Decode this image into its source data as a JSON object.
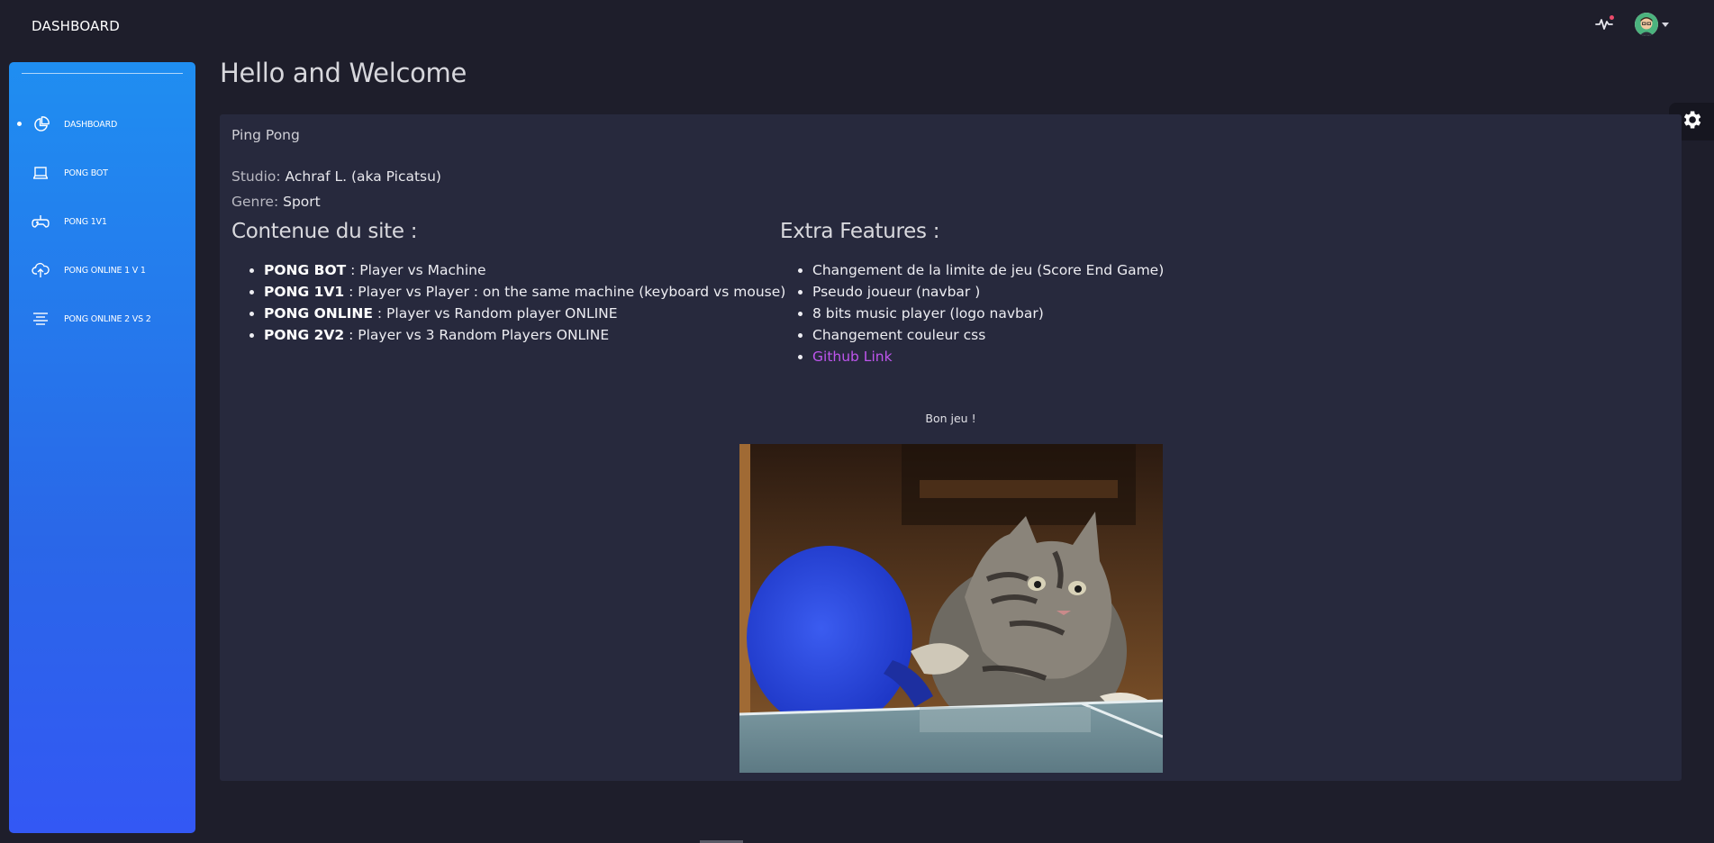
{
  "navbar": {
    "brand": "DASHBOARD",
    "activity_icon": "activity-pulse-icon",
    "notification_color": "#ec4b6b",
    "avatar_icon": "user-avatar"
  },
  "sidebar": {
    "items": [
      {
        "label": "DASHBOARD",
        "icon": "chart-pie-icon",
        "active": true
      },
      {
        "label": "PONG BOT",
        "icon": "laptop-icon"
      },
      {
        "label": "PONG 1V1",
        "icon": "controller-icon"
      },
      {
        "label": "PONG ONLINE 1 V 1",
        "icon": "cloud-upload-icon"
      },
      {
        "label": "PONG ONLINE 2 VS 2",
        "icon": "align-center-icon"
      }
    ]
  },
  "page": {
    "title": "Hello and Welcome"
  },
  "game": {
    "title": "Ping Pong",
    "studio_label": "Studio:",
    "studio_value": "Achraf L. (aka Picatsu)",
    "genre_label": "Genre:",
    "genre_value": "Sport",
    "content": {
      "heading": "Contenue du site :",
      "items": [
        {
          "name": "PONG BOT",
          "desc": " : Player vs Machine"
        },
        {
          "name": "PONG 1V1",
          "desc": " : Player vs Player : on the same machine (keyboard vs mouse)"
        },
        {
          "name": "PONG ONLINE",
          "desc": " : Player vs Random player ONLINE"
        },
        {
          "name": "PONG 2V2",
          "desc": " : Player vs 3 Random Players ONLINE"
        }
      ]
    },
    "features": {
      "heading": "Extra Features :",
      "items": [
        "Changement de la limite de jeu (Score End Game)",
        "Pseudo joueur (navbar )",
        "8 bits music player (logo navbar)",
        "Changement couleur css"
      ],
      "link_label": "Github Link"
    },
    "farewell": "Bon jeu !",
    "image": "cat-playing-ping-pong-picture"
  },
  "colors": {
    "sidebar_gradient_start": "#1f8ef1",
    "sidebar_gradient_end": "#3358f4",
    "background": "#1e1e2b",
    "card": "#27293d",
    "link": "#be55ed"
  }
}
